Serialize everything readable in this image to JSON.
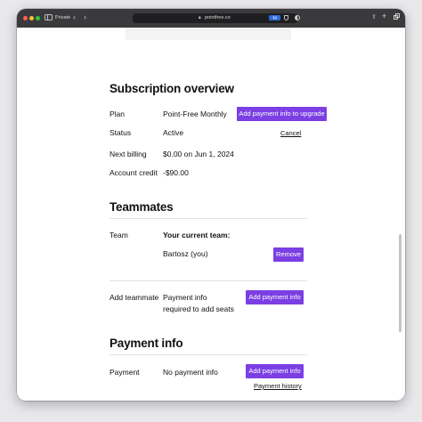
{
  "browser": {
    "mode_label": "Private",
    "url": "pointfree.co",
    "extension_badge": "1p"
  },
  "subscription": {
    "heading": "Subscription overview",
    "plan_label": "Plan",
    "plan_value": "Point-Free Monthly",
    "upgrade_button": "Add payment info to upgrade",
    "status_label": "Status",
    "status_value": "Active",
    "cancel_link": "Cancel",
    "billing_label": "Next billing",
    "billing_value": "$0.00 on Jun 1, 2024",
    "credit_label": "Account credit",
    "credit_value": "-$90.00"
  },
  "teammates": {
    "heading": "Teammates",
    "team_label": "Team",
    "team_header": "Your current team:",
    "member_name": "Bartosz (you)",
    "remove_button": "Remove",
    "add_label": "Add teammate",
    "add_note_line1": "Payment info",
    "add_note_line2": "required to add seats",
    "add_payment_button": "Add payment info"
  },
  "payment": {
    "heading": "Payment info",
    "payment_label": "Payment",
    "payment_value": "No payment info",
    "add_payment_button": "Add payment info",
    "history_link": "Payment history"
  }
}
